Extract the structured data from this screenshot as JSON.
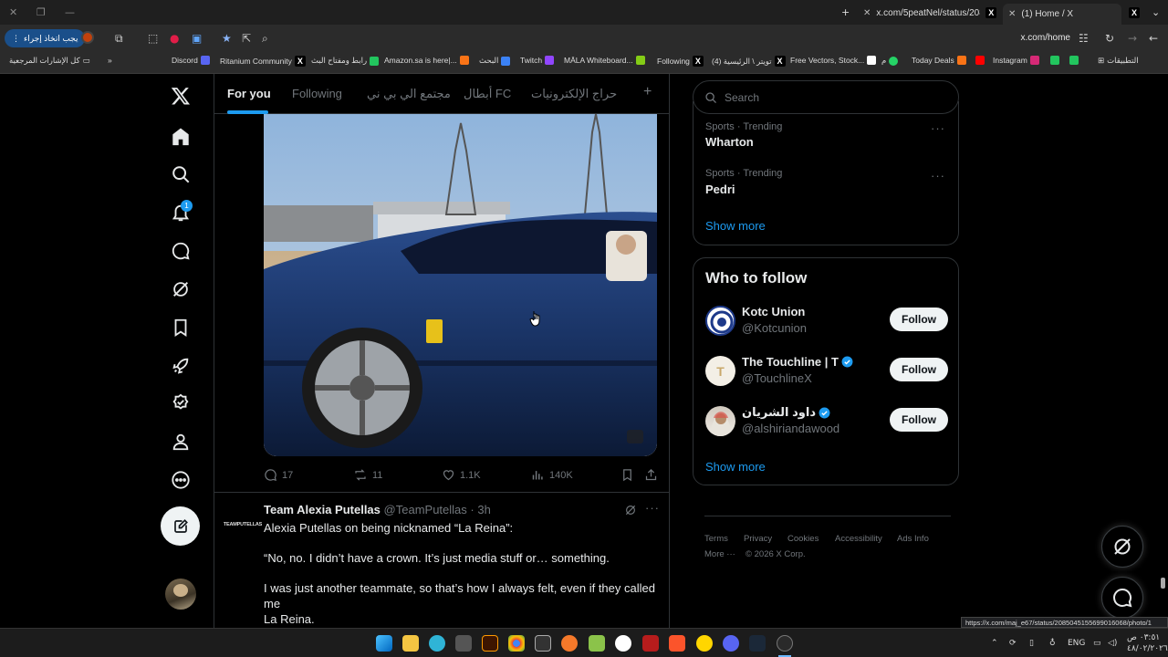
{
  "browser": {
    "tabs": [
      {
        "title": "x.com/5peatNel/status/208549...",
        "active": false
      },
      {
        "title": "(1) Home / X",
        "active": true
      }
    ],
    "action_button": "يجب اتخاذ إجراء",
    "url": "x.com/home",
    "bookmarks_all": "كل الإشارات المرجعية",
    "bookmarks_apps": "التطبيقات",
    "bookmarks": [
      "Discord",
      "Ritanium Community",
      "رابط ومفتاح البث",
      "Amazon.sa is here|...",
      "البحث",
      "Twitch",
      "MĀLA Whiteboard...",
      "Following",
      "تويتر \\ الرئيسية (4)",
      "Free Vectors, Stock...",
      "م",
      "Today Deals",
      "Instagram"
    ]
  },
  "nav": {
    "notification_count": "1"
  },
  "feed_tabs": [
    "For you",
    "Following",
    "مجتمع الي بي ني",
    "أبطال FC",
    "حراج الإلكترونيات"
  ],
  "tweet1": {
    "replies": "17",
    "reposts": "11",
    "likes": "1.1K",
    "views": "140K"
  },
  "tweet2": {
    "author": "Team Alexia Putellas",
    "handle": "@TeamPutellas",
    "time": "3h",
    "avatar_text": "TEAMPUTELLAS",
    "line1": "Alexia Putellas on being nicknamed “La Reina”:",
    "line2": "“No, no. I didn’t have a crown. It’s just media stuff or… something.",
    "line3": "I was just another teammate, so that’s how I always felt, even if they called me",
    "line4": "La Reina."
  },
  "right": {
    "search_placeholder": "Search",
    "trends": [
      {
        "meta": "Sports · Trending",
        "name": "Wharton"
      },
      {
        "meta": "Sports · Trending",
        "name": "Pedri"
      }
    ],
    "trends_show_more": "Show more",
    "wtf_title": "Who to follow",
    "who_to_follow": [
      {
        "name": "Kotc Union",
        "handle": "@Kotcunion",
        "verified": false,
        "follow": "Follow"
      },
      {
        "name": "The Touchline | T",
        "handle": "@TouchlineX",
        "verified": true,
        "follow": "Follow"
      },
      {
        "name": "داود الشريان",
        "handle": "@alshiriandawood",
        "verified": true,
        "follow": "Follow"
      }
    ],
    "wtf_show_more": "Show more",
    "footer": [
      "Terms",
      "Privacy",
      "Cookies",
      "Accessibility",
      "Ads Info",
      "More ···",
      "© 2026 X Corp."
    ]
  },
  "status_url": "https://x.com/maj_e67/status/2085045155699016068/photo/1",
  "taskbar": {
    "lang": "ENG",
    "time": "٠٣:٥١ ص",
    "date": "٤٨/٠٢/٢٠٢٦"
  },
  "colors": {
    "accent": "#1d9bf0",
    "border": "#2f3336",
    "muted": "#71767b"
  }
}
